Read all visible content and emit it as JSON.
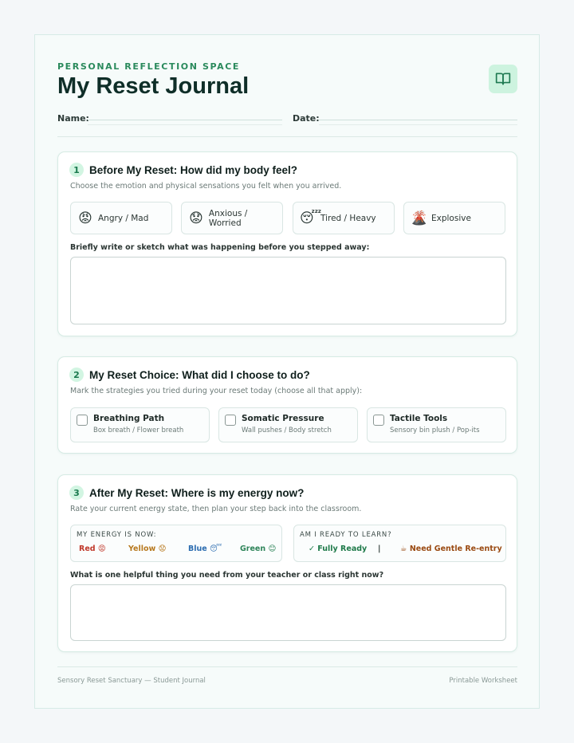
{
  "header": {
    "kicker": "PERSONAL REFLECTION SPACE",
    "title": "My Reset Journal",
    "logo_icon": "open-book-icon",
    "name_label": "Name:",
    "date_label": "Date:"
  },
  "section1": {
    "number": "1",
    "title": "Before My Reset: How did my body feel?",
    "subtitle": "Choose the emotion and physical sensations you felt when you arrived.",
    "emotions": [
      {
        "emoji": "😡",
        "label": "Angry / Mad"
      },
      {
        "emoji": "😟",
        "label": "Anxious / Worried"
      },
      {
        "emoji": "😴",
        "label": "Tired / Heavy"
      },
      {
        "emoji": "🌋",
        "label": "Explosive"
      }
    ],
    "prompt": "Briefly write or sketch what was happening before you stepped away:"
  },
  "section2": {
    "number": "2",
    "title": "My Reset Choice: What did I choose to do?",
    "subtitle": "Mark the strategies you tried during your reset today (choose all that apply):",
    "strategies": [
      {
        "title": "Breathing Path",
        "detail": "Box breath / Flower breath"
      },
      {
        "title": "Somatic Pressure",
        "detail": "Wall pushes / Body stretch"
      },
      {
        "title": "Tactile Tools",
        "detail": "Sensory bin plush / Pop-its"
      }
    ]
  },
  "section3": {
    "number": "3",
    "title": "After My Reset: Where is my energy now?",
    "subtitle": "Rate your current energy state, then plan your step back into the classroom.",
    "energy_caption": "MY ENERGY IS NOW:",
    "energy_options": [
      "Red 😡",
      "Yellow 😟",
      "Blue 😴",
      "Green 😊"
    ],
    "ready_caption": "AM I READY TO LEARN?",
    "ready_yes": "✓ Fully Ready",
    "ready_sep": "|",
    "ready_gentle": "☕ Need Gentle Re-entry",
    "prompt": "What is one helpful thing you need from your teacher or class right now?"
  },
  "footer": {
    "left": "Sensory Reset Sanctuary — Student Journal",
    "right": "Printable Worksheet"
  },
  "colors": {
    "accent": "#2a8a5c",
    "red": "#c0392b",
    "yellow": "#b7791f",
    "blue": "#2b6cb0",
    "green": "#2f855a"
  }
}
